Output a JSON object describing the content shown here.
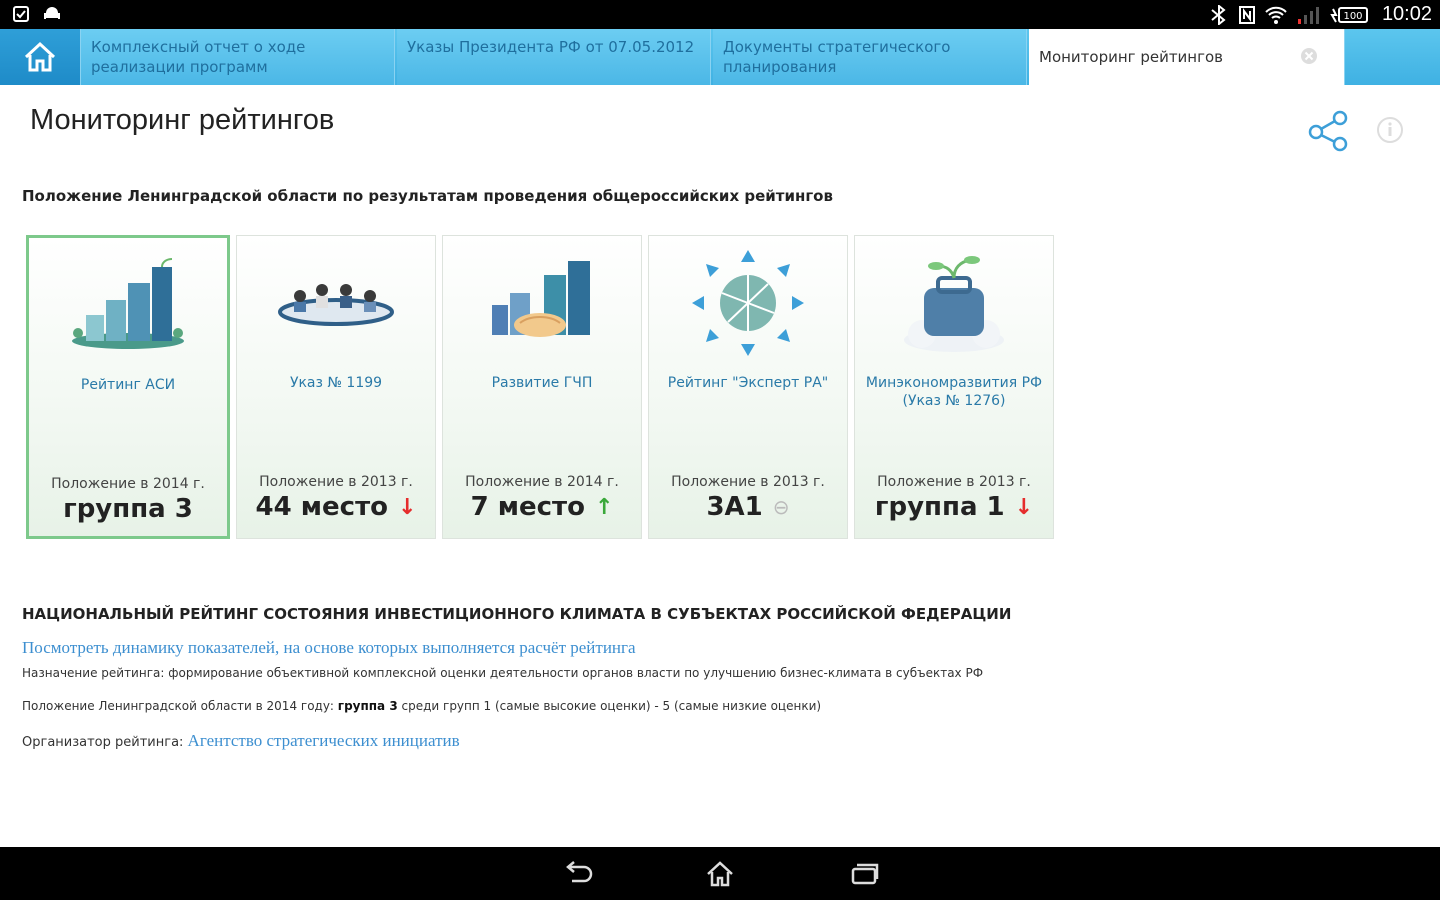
{
  "status_bar": {
    "time": "10:02",
    "battery": "100"
  },
  "tabs": {
    "home": "home",
    "items": [
      {
        "label": "Комплексный отчет о ходе реализации программ"
      },
      {
        "label": "Указы Президента РФ от 07.05.2012"
      },
      {
        "label": "Документы стратегического планирования"
      },
      {
        "label": "Мониторинг рейтингов"
      }
    ]
  },
  "page": {
    "title": "Мониторинг рейтингов",
    "section_heading": "Положение Ленинградской области по результатам проведения общероссийских рейтингов"
  },
  "cards": [
    {
      "name": "Рейтинг АСИ",
      "position_label": "Положение в 2014 г.",
      "value": "группа 3",
      "trend": "none"
    },
    {
      "name": "Указ № 1199",
      "position_label": "Положение в 2013 г.",
      "value": "44 место",
      "trend": "down"
    },
    {
      "name": "Развитие ГЧП",
      "position_label": "Положение в 2014 г.",
      "value": "7 место",
      "trend": "up"
    },
    {
      "name": "Рейтинг \"Эксперт РА\"",
      "position_label": "Положение в 2013 г.",
      "value": "3А1",
      "trend": "neutral"
    },
    {
      "name": "Минэкономразвития РФ (Указ № 1276)",
      "position_label": "Положение в 2013 г.",
      "value": "группа 1",
      "trend": "down"
    }
  ],
  "national": {
    "heading": "НАЦИОНАЛЬНЫЙ РЕЙТИНГ СОСТОЯНИЯ ИНВЕСТИЦИОННОГО КЛИМАТА В СУБЪЕКТАХ РОССИЙСКОЙ ФЕДЕРАЦИИ",
    "link": "Посмотреть динамику показателей, на основе которых выполняется расчёт рейтинга",
    "purpose": "Назначение рейтинга: формирование объективной комплексной оценки деятельности органов власти по улучшению бизнес-климата в субъектах РФ",
    "position_prefix": "Положение Ленинградской области в 2014 году: ",
    "position_value": "группа 3",
    "position_suffix": " среди групп 1 (самые высокие оценки) - 5 (самые низкие оценки)",
    "organizer_label": "Организатор рейтинга: ",
    "organizer_link": "Агентство стратегических инициатив"
  },
  "colors": {
    "tab_bar": "#4bb7e6",
    "link": "#3d8fd0",
    "selected_border": "#7dc98b",
    "down": "#e52d2d",
    "up": "#3aa83a"
  },
  "icons": {
    "arrow_down": "↓",
    "arrow_up": "↑",
    "neutral": "⊖"
  }
}
